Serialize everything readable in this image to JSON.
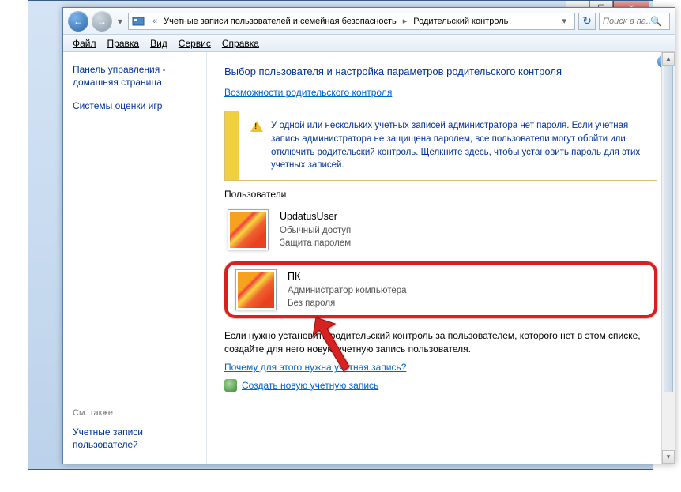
{
  "window_controls": {
    "min": "─",
    "max": "☐",
    "close": "✕"
  },
  "nav": {
    "back": "←",
    "fwd": "→"
  },
  "breadcrumb": {
    "seg1": "Учетные записи пользователей и семейная безопасность",
    "seg2": "Родительский контроль"
  },
  "search": {
    "placeholder": "Поиск в па..."
  },
  "menu": {
    "file": "Файл",
    "edit": "Правка",
    "view": "Вид",
    "service": "Сервис",
    "help": "Справка"
  },
  "left": {
    "link1": "Панель управления - домашняя страница",
    "link2": "Системы оценки игр",
    "see_also": "См. также",
    "link3": "Учетные записи пользователей"
  },
  "main": {
    "title": "Выбор пользователя и настройка параметров родительского контроля",
    "sublink": "Возможности родительского контроля",
    "warning": "У одной или нескольких учетных записей администратора нет пароля. Если учетная запись администратора не защищена паролем, все пользователи могут обойти или отключить родительский контроль. Щелкните здесь, чтобы установить пароль для этих учетных записей.",
    "users_label": "Пользователи",
    "users": [
      {
        "name": "UpdatusUser",
        "line2": "Обычный доступ",
        "line3": "Защита паролем"
      },
      {
        "name": "ПК",
        "line2": "Администратор компьютера",
        "line3": "Без пароля"
      }
    ],
    "footer_text": "Если нужно установить родительский контроль за пользователем, которого нет в этом списке, создайте для него новую учетную запись пользователя.",
    "footer_link": "Почему для этого нужна учетная запись?",
    "create_link": "Создать новую учетную запись"
  }
}
